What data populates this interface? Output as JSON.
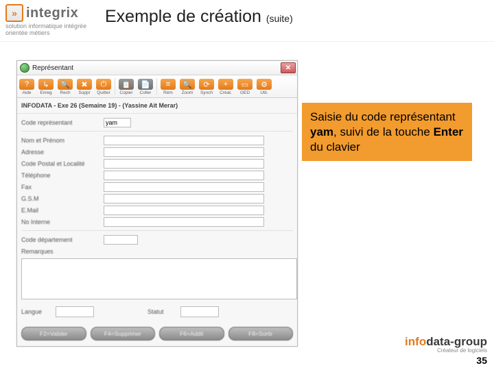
{
  "brand": {
    "name": "integrix",
    "tagline": "solution informatique intégrée orientée métiers",
    "mark_letter": "»"
  },
  "slide": {
    "title": "Exemple de création",
    "title_suffix": "(suite)",
    "page_number": "35"
  },
  "callout": {
    "pre": "Saisie du code représentant ",
    "code": "yam",
    "mid": ", suivi de la touche ",
    "key": "Enter",
    "post": " du clavier"
  },
  "footer_brand": {
    "part1": "info",
    "part2": "data",
    "part3": "-group",
    "tagline": "Créateur de logiciels"
  },
  "window": {
    "title": "Représentant",
    "close_glyph": "✕",
    "context_line": "INFODATA  -  Exe 26 (Semaine 19)  -  (Yassine Ait Merar)"
  },
  "toolbar": {
    "items": [
      {
        "label": "Aide",
        "glyph": "?",
        "cls": "orange"
      },
      {
        "label": "Enreg",
        "glyph": "↳",
        "cls": "orange"
      },
      {
        "label": "Rech",
        "glyph": "🔍",
        "cls": "orange"
      },
      {
        "label": "Suppr",
        "glyph": "✖",
        "cls": "orange"
      },
      {
        "label": "Quitter",
        "glyph": "⏻",
        "cls": "orange"
      },
      {
        "label": "Copier",
        "glyph": "📋",
        "cls": "grey",
        "sep_before": true
      },
      {
        "label": "Coller",
        "glyph": "📄",
        "cls": "grey"
      },
      {
        "label": "Rém",
        "glyph": "≡",
        "cls": "orange",
        "sep_before": true
      },
      {
        "label": "Zoom",
        "glyph": "🔍",
        "cls": "orange"
      },
      {
        "label": "Synch",
        "glyph": "⟳",
        "cls": "orange"
      },
      {
        "label": "Créat.",
        "glyph": "+",
        "cls": "orange"
      },
      {
        "label": "GED",
        "glyph": "▭",
        "cls": "orange"
      },
      {
        "label": "Util.",
        "glyph": "⚙",
        "cls": "orange"
      }
    ]
  },
  "form": {
    "code_label": "Code représentant",
    "code_value": "yam",
    "fields": [
      {
        "label": "Nom et Prénom",
        "width": "wide"
      },
      {
        "label": "Adresse",
        "width": "wide"
      },
      {
        "label": "Code Postal et Localité",
        "width": "wide"
      },
      {
        "label": "Téléphone",
        "width": "wide"
      },
      {
        "label": "Fax",
        "width": "wide"
      },
      {
        "label": "G.S.M",
        "width": "wide"
      },
      {
        "label": "E.Mail",
        "width": "wide"
      },
      {
        "label": "No Interne",
        "width": "wide"
      }
    ],
    "dept_label": "Code département",
    "remarks_label": "Remarques",
    "langue_label": "Langue",
    "statut_label": "Statut"
  },
  "app_buttons": [
    {
      "label": "F2=Valider"
    },
    {
      "label": "F4=Supprimer"
    },
    {
      "label": "F6=Addit"
    },
    {
      "label": "F8=Sortir"
    }
  ]
}
